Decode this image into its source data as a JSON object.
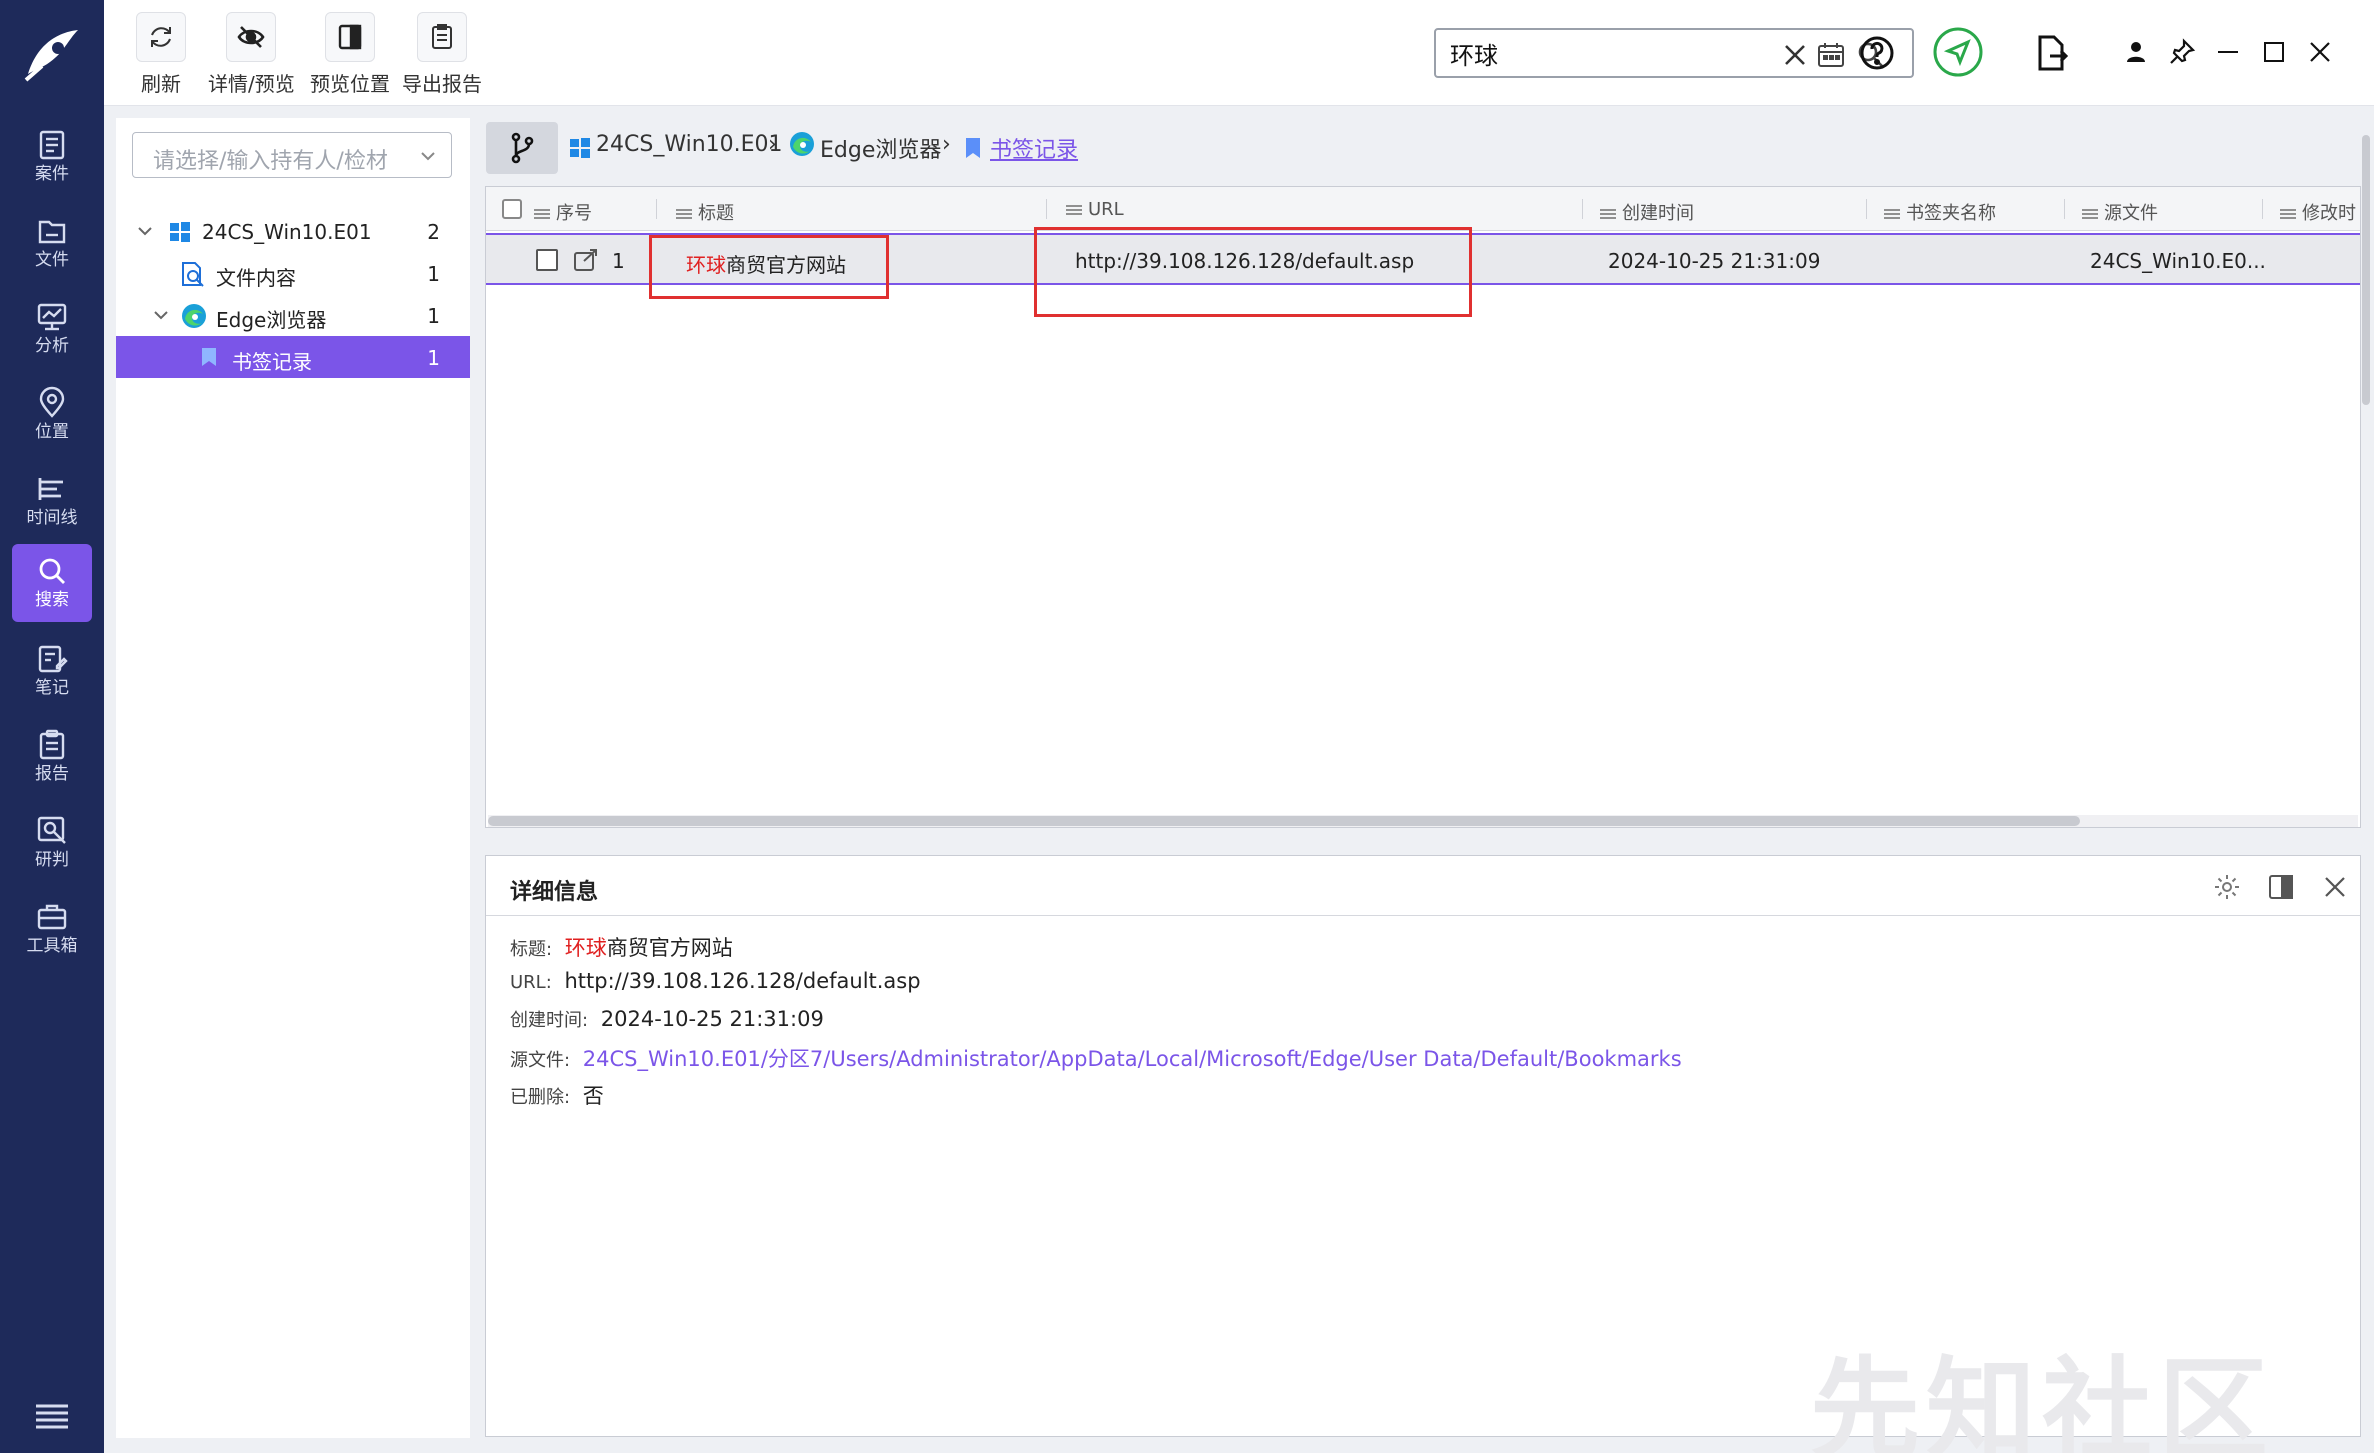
{
  "nav": {
    "items": [
      {
        "label": "案件",
        "icon": "case-icon"
      },
      {
        "label": "文件",
        "icon": "file-icon"
      },
      {
        "label": "分析",
        "icon": "analysis-icon"
      },
      {
        "label": "位置",
        "icon": "location-icon"
      },
      {
        "label": "时间线",
        "icon": "timeline-icon"
      },
      {
        "label": "搜索",
        "icon": "search-icon",
        "active": true
      },
      {
        "label": "笔记",
        "icon": "note-icon"
      },
      {
        "label": "报告",
        "icon": "report-icon"
      },
      {
        "label": "研判",
        "icon": "judge-icon"
      },
      {
        "label": "工具箱",
        "icon": "toolbox-icon"
      }
    ]
  },
  "toolbar": {
    "refresh": "刷新",
    "detail_preview": "详情/预览",
    "preview_position": "预览位置",
    "export_report": "导出报告",
    "search_value": "环球"
  },
  "tree": {
    "combo_placeholder": "请选择/输入持有人/检材",
    "nodes": [
      {
        "label": "24CS_Win10.E01",
        "count": "2"
      },
      {
        "label": "文件内容",
        "count": "1"
      },
      {
        "label": "Edge浏览器",
        "count": "1"
      },
      {
        "label": "书签记录",
        "count": "1"
      }
    ]
  },
  "breadcrumb": {
    "items": [
      "24CS_Win10.E01",
      "Edge浏览器",
      "书签记录"
    ]
  },
  "grid": {
    "columns": [
      "序号",
      "标题",
      "URL",
      "创建时间",
      "书签夹名称",
      "源文件",
      "修改时"
    ],
    "row": {
      "index": "1",
      "title_hl": "环球",
      "title_rest": "商贸官方网站",
      "url": "http://39.108.126.128/default.asp",
      "created": "2024-10-25 21:31:09",
      "folder": "",
      "source": "24CS_Win10.E0..."
    }
  },
  "details": {
    "header": "详细信息",
    "title_label": "标题:",
    "title_hl": "环球",
    "title_rest": "商贸官方网站",
    "url_label": "URL:",
    "url_value": "http://39.108.126.128/default.asp",
    "created_label": "创建时间:",
    "created_value": "2024-10-25 21:31:09",
    "source_label": "源文件:",
    "source_value": "24CS_Win10.E01/分区7/Users/Administrator/AppData/Local/Microsoft/Edge/User Data/Default/Bookmarks",
    "deleted_label": "已删除:",
    "deleted_value": "否"
  },
  "watermark": "先知社区",
  "colors": {
    "accent": "#7b55e8",
    "nav_bg": "#1e2a5a",
    "highlight": "#e02020"
  }
}
